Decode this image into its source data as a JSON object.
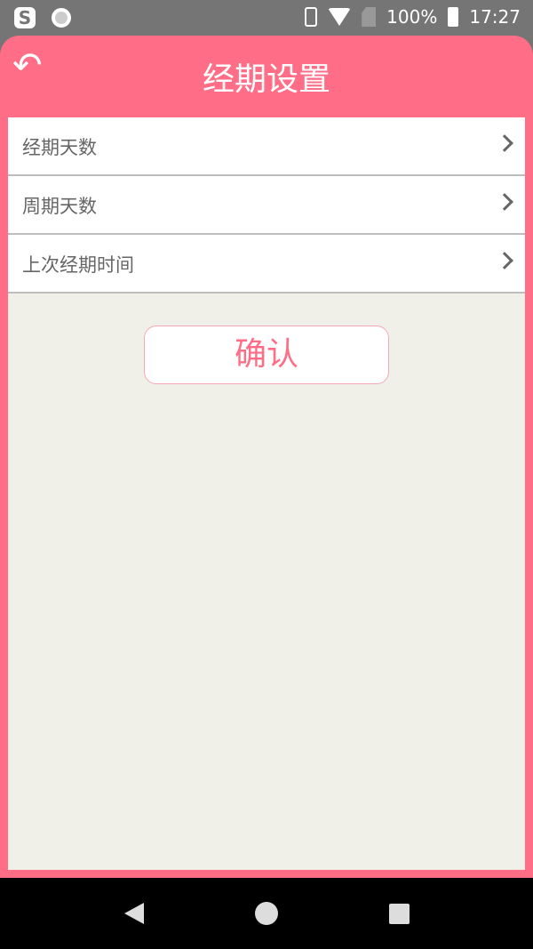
{
  "status_bar": {
    "battery": "100%",
    "time": "17:27",
    "icons": [
      "sogou-icon",
      "record-icon",
      "vibrate-icon",
      "wifi-off-icon",
      "no-sim-icon",
      "battery-charging-icon"
    ]
  },
  "header": {
    "title": "经期设置",
    "back_icon": "back-arrow-icon"
  },
  "settings": {
    "items": [
      {
        "label": "经期天数"
      },
      {
        "label": "周期天数"
      },
      {
        "label": "上次经期时间"
      }
    ]
  },
  "confirm": {
    "label": "确认"
  },
  "colors": {
    "accent": "#ff6e86",
    "panel": "#f0f0e8"
  }
}
